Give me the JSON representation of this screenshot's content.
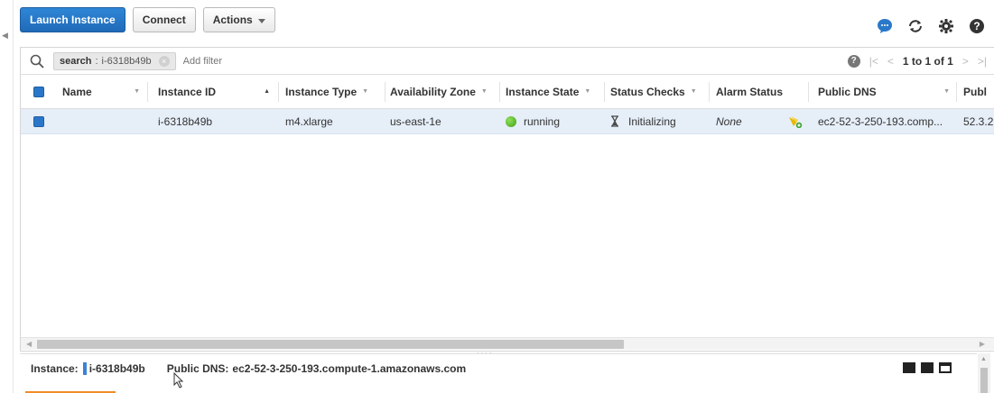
{
  "toolbar": {
    "launch_label": "Launch Instance",
    "connect_label": "Connect",
    "actions_label": "Actions"
  },
  "top_icons": [
    "chat-icon",
    "refresh-icon",
    "settings-icon",
    "help-icon"
  ],
  "filter": {
    "token_key": "search",
    "token_sep": ":",
    "token_value": "i-6318b49b",
    "add_filter_placeholder": "Add filter"
  },
  "pager": {
    "first": "|<",
    "prev": "<",
    "count": "1 to 1 of 1",
    "next": ">",
    "last": ">|"
  },
  "columns": [
    {
      "label": "Name"
    },
    {
      "label": "Instance ID"
    },
    {
      "label": "Instance Type"
    },
    {
      "label": "Availability Zone"
    },
    {
      "label": "Instance State"
    },
    {
      "label": "Status Checks"
    },
    {
      "label": "Alarm Status"
    },
    {
      "label": "Public DNS"
    },
    {
      "label": "Publ"
    }
  ],
  "rows": [
    {
      "name": "",
      "instance_id": "i-6318b49b",
      "instance_type": "m4.xlarge",
      "availability_zone": "us-east-1e",
      "instance_state": "running",
      "status_checks": "Initializing",
      "alarm_status": "None",
      "public_dns": "ec2-52-3-250-193.comp...",
      "public_ip": "52.3.2"
    }
  ],
  "detail": {
    "instance_label": "Instance:",
    "instance_value": "i-6318b49b",
    "dns_label": "Public DNS:",
    "dns_value": "ec2-52-3-250-193.compute-1.amazonaws.com"
  },
  "colors": {
    "primary": "#1f6ab8",
    "row_selected": "#e6eef8",
    "running": "#3fa015",
    "selection_bar": "#3b82d6",
    "orange_tab": "#f08c2a"
  }
}
